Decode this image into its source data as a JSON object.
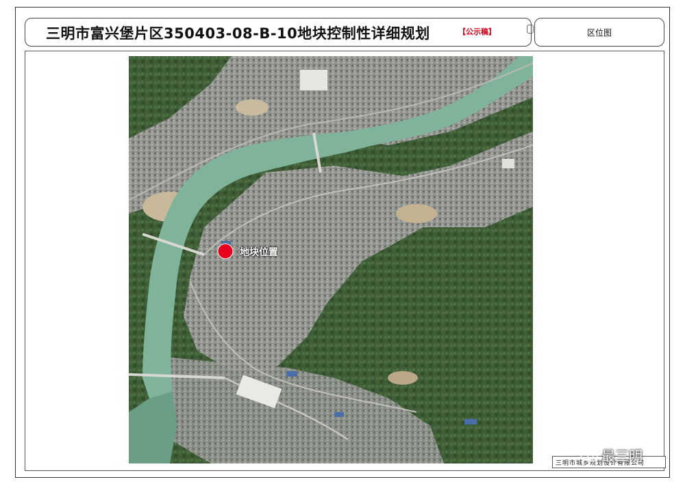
{
  "header": {
    "title": "三明市富兴堡片区350403-08-B-10地块控制性详细规划",
    "badge": "【公示稿】",
    "panel_label": "区位图"
  },
  "map": {
    "marker_label": "地块位置",
    "marker_color": "#e8001c",
    "river_color": "#7fb49a",
    "forest_color": "#3d5a36",
    "urban_color": "#8a8c88"
  },
  "footer": {
    "firm_name": "三明市城乡规划设计有限公司",
    "watermark": "最三明"
  }
}
